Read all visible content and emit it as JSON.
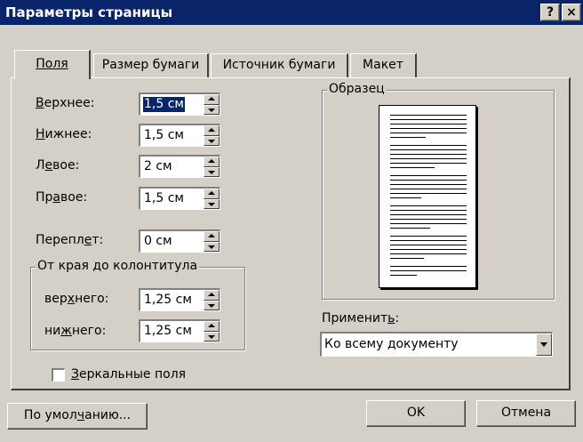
{
  "window": {
    "title": "Параметры страницы",
    "help_glyph": "?",
    "close_glyph": "×"
  },
  "tabs": [
    {
      "label": "Поля",
      "active": true
    },
    {
      "label": "Размер бумаги",
      "active": false
    },
    {
      "label": "Источник бумаги",
      "active": false
    },
    {
      "label": "Макет",
      "active": false
    }
  ],
  "margins": {
    "top": {
      "label_pre": "",
      "label_u": "В",
      "label_post": "ерхнее:",
      "value": "1,5 см"
    },
    "bottom": {
      "label_pre": "",
      "label_u": "Н",
      "label_post": "ижнее:",
      "value": "1,5 см"
    },
    "left": {
      "label_pre": "Л",
      "label_u": "е",
      "label_post": "вое:",
      "value": "2 см"
    },
    "right": {
      "label_pre": "Пр",
      "label_u": "а",
      "label_post": "вое:",
      "value": "1,5 см"
    },
    "gutter": {
      "label_pre": "Перепл",
      "label_u": "е",
      "label_post": "т:",
      "value": "0 см"
    }
  },
  "header_footer_group": {
    "title": "От края до колонтитула",
    "header": {
      "label_pre": "вер",
      "label_u": "х",
      "label_post": "него:",
      "value": "1,25 см"
    },
    "footer": {
      "label_pre": "ни",
      "label_u": "ж",
      "label_post": "него:",
      "value": "1,25 см"
    }
  },
  "mirror_margins": {
    "label_u": "З",
    "label_post": "еркальные поля",
    "checked": false
  },
  "preview": {
    "title": "Образец"
  },
  "apply": {
    "label_pre": "Применит",
    "label_u": "ь",
    "label_post": ":",
    "value": "Ко всему документу"
  },
  "buttons": {
    "default_pre": "По умол",
    "default_u": "ч",
    "default_post": "анию...",
    "ok": "OK",
    "cancel": "Отмена"
  }
}
